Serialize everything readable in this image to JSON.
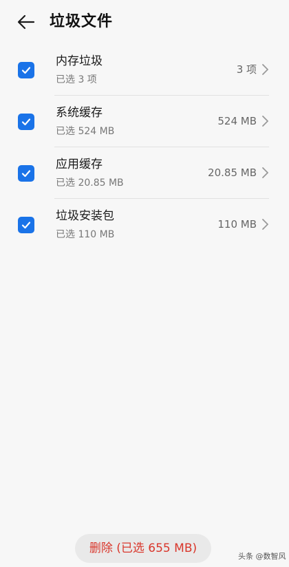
{
  "header": {
    "title": "垃圾文件",
    "back_icon": "arrow-left-icon"
  },
  "items": [
    {
      "title": "内存垃圾",
      "subtitle": "已选 3 项",
      "value": "3 项",
      "checked": true
    },
    {
      "title": "系统缓存",
      "subtitle": "已选 524 MB",
      "value": "524 MB",
      "checked": true
    },
    {
      "title": "应用缓存",
      "subtitle": "已选 20.85 MB",
      "value": "20.85 MB",
      "checked": true
    },
    {
      "title": "垃圾安装包",
      "subtitle": "已选 110 MB",
      "value": "110 MB",
      "checked": true
    }
  ],
  "footer": {
    "delete_label": "删除 (已选 655 MB)"
  },
  "watermark": "头条 @数智风",
  "colors": {
    "accent": "#1a73e8",
    "danger": "#d9362b",
    "background": "#f7f7f7"
  }
}
